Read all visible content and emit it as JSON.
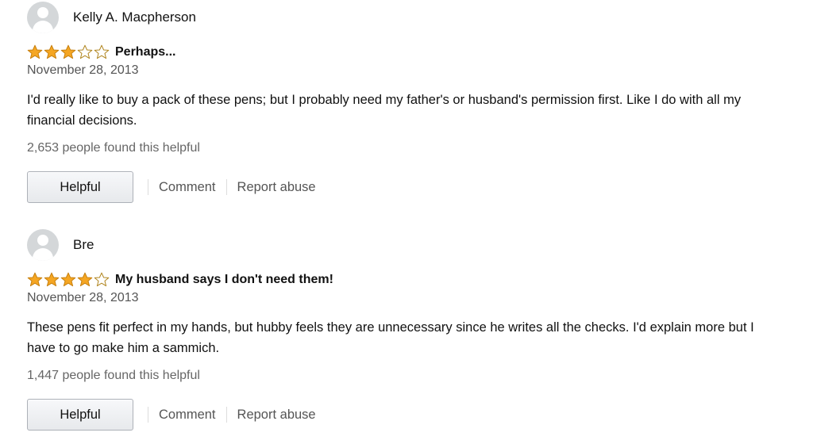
{
  "reviews": [
    {
      "reviewer": "Kelly A. Macpherson",
      "rating": 3,
      "rating_max": 5,
      "title": "Perhaps...",
      "date": "November 28, 2013",
      "body": "I'd really like to buy a pack of these pens; but I probably need my father's or husband's permission first. Like I do with all my financial decisions.",
      "helpful_count_text": "2,653 people found this helpful",
      "helpful_label": "Helpful",
      "comment_label": "Comment",
      "report_label": "Report abuse"
    },
    {
      "reviewer": "Bre",
      "rating": 4,
      "rating_max": 5,
      "title": "My husband says I don't need them!",
      "date": "November 28, 2013",
      "body": "These pens fit perfect in my hands, but hubby feels they are unnecessary since he writes all the checks. I'd explain more but I have to go make him a sammich.",
      "helpful_count_text": "1,447 people found this helpful",
      "helpful_label": "Helpful",
      "comment_label": "Comment",
      "report_label": "Report abuse"
    }
  ],
  "colors": {
    "star_fill": "#f5a623",
    "star_stroke": "#c7800f",
    "star_empty_stroke": "#b0851f"
  },
  "icons": {
    "avatar": "default-avatar-icon",
    "star_full": "star-filled-icon",
    "star_empty": "star-empty-icon"
  }
}
